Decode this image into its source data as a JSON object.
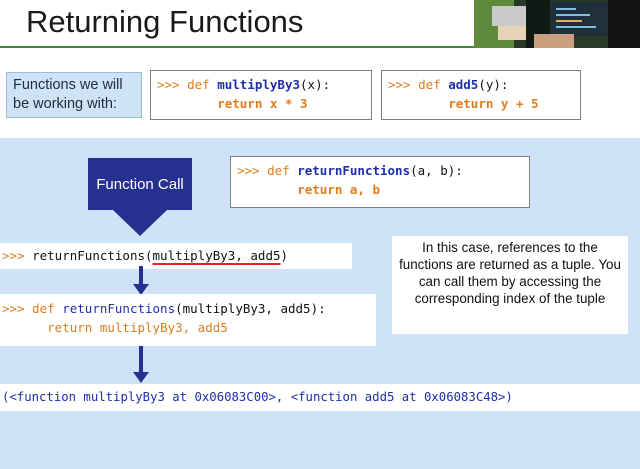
{
  "slide": {
    "title": "Returning Functions"
  },
  "intro": {
    "label": "Functions we will be working with:"
  },
  "code_multiply": {
    "prompt": ">>>",
    "keyword": "def",
    "name": "multiplyBy3",
    "params": "(x):",
    "body": "return x * 3"
  },
  "code_add": {
    "prompt": ">>>",
    "keyword": "def",
    "name": "add5",
    "params": "(y):",
    "body": "return y + 5"
  },
  "function_call_label": "Function Call",
  "code_return_functions": {
    "prompt": ">>>",
    "keyword": "def",
    "name": "returnFunctions",
    "params": "(a, b):",
    "body": "return a, b"
  },
  "call_line": {
    "prompt": ">>>",
    "fn": "returnFunctions",
    "open": "(",
    "arg1": "multiplyBy3",
    "sep": ", ",
    "arg2": "add5",
    "close": ")"
  },
  "note": {
    "text": "In this case, references to the functions are returned as a tuple. You can call them by accessing the corresponding index of the tuple"
  },
  "expanded_def": {
    "prompt": ">>>",
    "keyword": "def",
    "name": "returnFunctions",
    "params": "(multiplyBy3, add5):",
    "body": "return multiplyBy3, add5"
  },
  "output": {
    "text": "(<function multiplyBy3 at 0x06083C00>, <function add5 at 0x06083C48>)"
  },
  "colors": {
    "prompt_orange": "#e07c1c",
    "function_blue": "#1e2fa8",
    "arrow_navy": "#26318f",
    "panel_blue": "#cfe3f8",
    "underline_red": "#e52222",
    "title_rule_green": "#3b8a3b"
  }
}
